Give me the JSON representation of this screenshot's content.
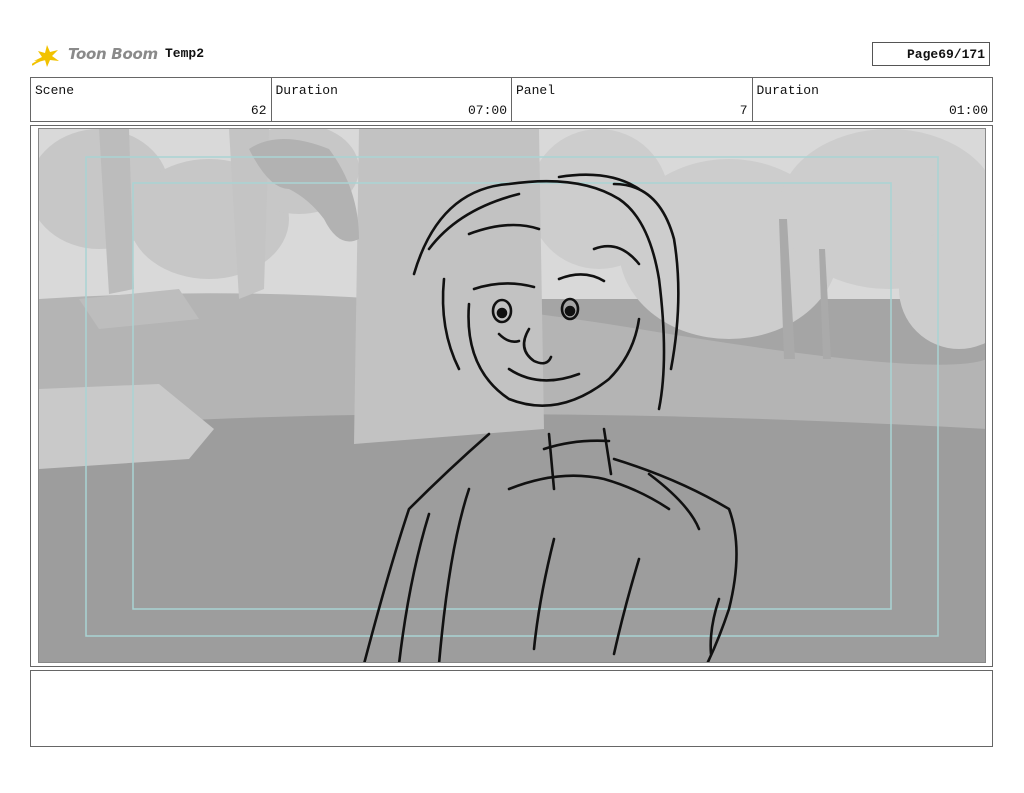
{
  "header": {
    "logo_text": "Toon Boom",
    "project": "Temp2",
    "page_label": "Page",
    "page_value": "69/171"
  },
  "info": {
    "scene_label": "Scene",
    "scene_value": "62",
    "duration_label": "Duration",
    "duration_value": "07:00",
    "panel_label": "Panel",
    "panel_value": "7",
    "panel_duration_label": "Duration",
    "panel_duration_value": "01:00"
  },
  "panel": {
    "description": "",
    "notes": ""
  },
  "colors": {
    "logo_star": "#f2c200",
    "safe_frame": "#a9d4d4",
    "sketch": "#111111"
  },
  "icons": {
    "logo": "toon-boom-star-icon"
  }
}
